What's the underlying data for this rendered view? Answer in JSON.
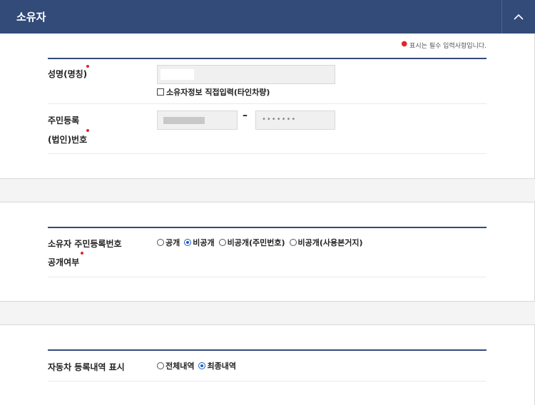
{
  "header": {
    "title": "소유자",
    "toggle_icon": "chevron-up-icon"
  },
  "required_note": "표시는 필수 입력사항입니다.",
  "owner": {
    "name_label": "성명(명칭)",
    "direct_input_label": "소유자정보 직접입력(타인차량)",
    "direct_input_checked": false,
    "rrn_label_line1": "주민등록",
    "rrn_label_line2": "(법인)번호",
    "rrn_dash": "–",
    "rrn_back_value": "•••••••"
  },
  "disclosure": {
    "label_line1": "소유자 주민등록번호",
    "label_line2": "공개여부",
    "options": [
      "공개",
      "비공개",
      "비공개(주민번호)",
      "비공개(사용본거지)"
    ],
    "selected": "비공개"
  },
  "history": {
    "label": "자동차 등록내역 표시",
    "options": [
      "전체내역",
      "최종내역"
    ],
    "selected": "최종내역"
  },
  "colors": {
    "header_bg": "#324b79",
    "required": "#e2252b",
    "radio_selected": "#1a5fc4"
  }
}
